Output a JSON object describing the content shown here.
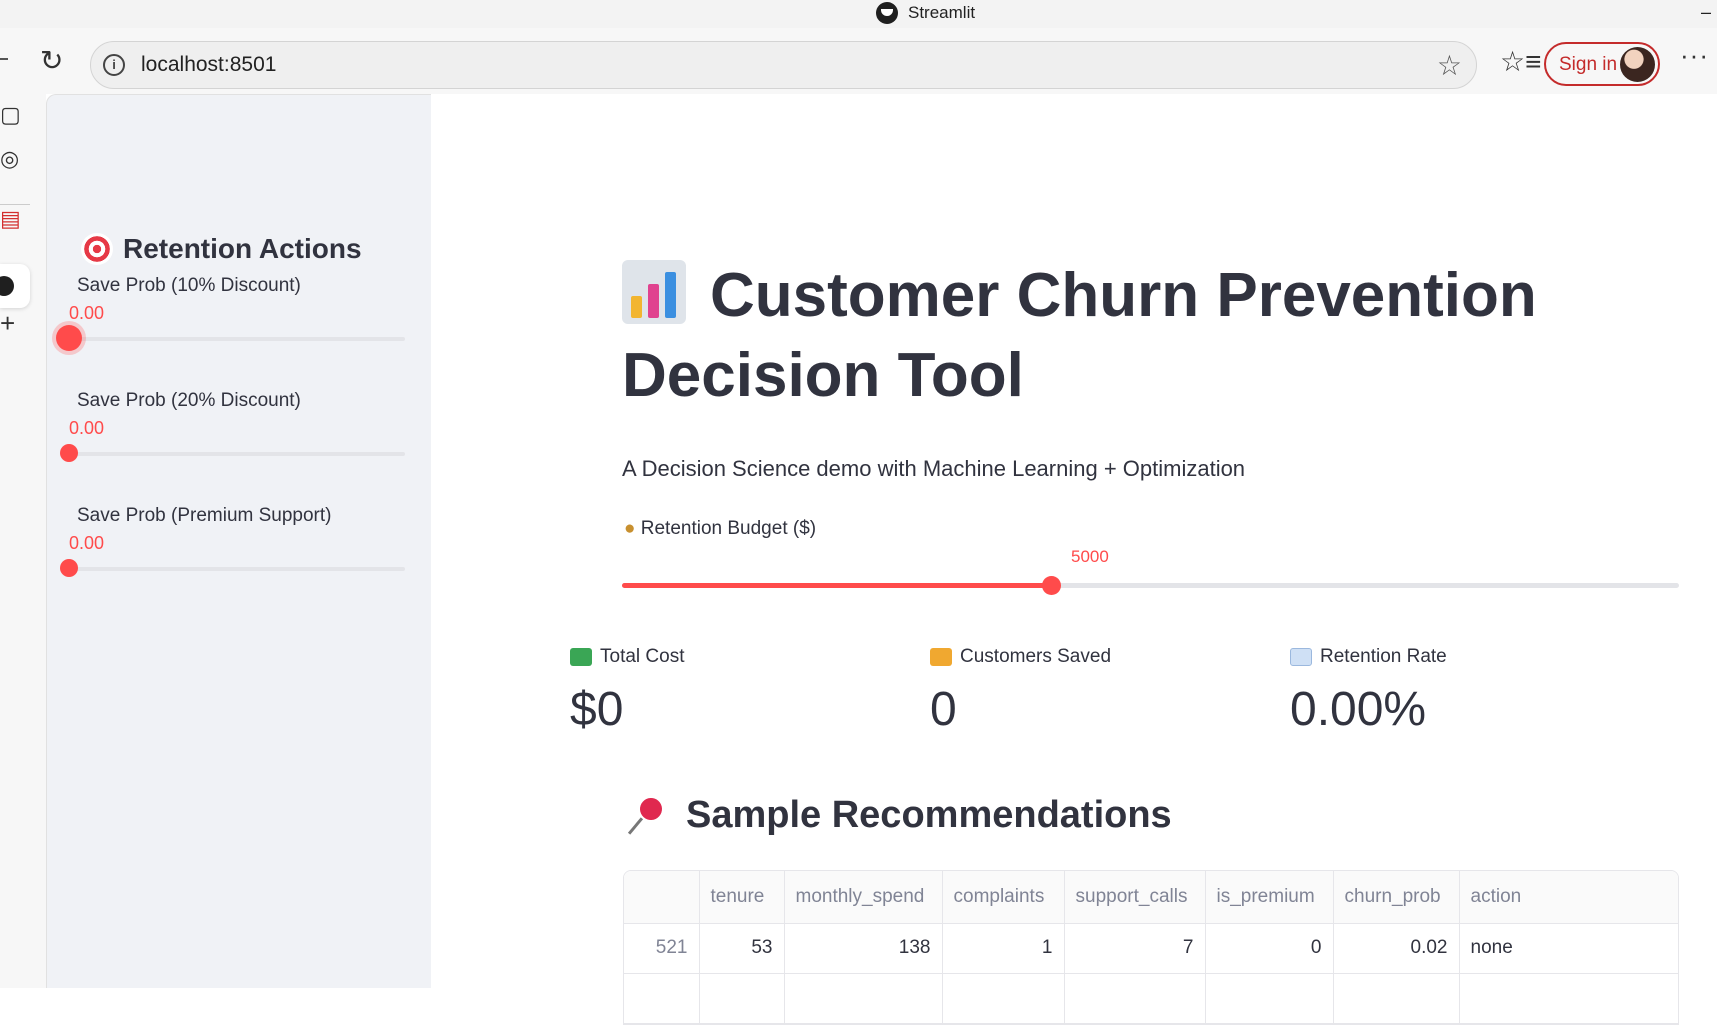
{
  "window": {
    "title": "Streamlit"
  },
  "browser": {
    "url": "localhost:8501",
    "sign_in_label": "Sign in"
  },
  "sidebar": {
    "heading": "Retention Actions",
    "sliders": [
      {
        "label": "Save Prob (10% Discount)",
        "value": "0.00"
      },
      {
        "label": "Save Prob (20% Discount)",
        "value": "0.00"
      },
      {
        "label": "Save Prob (Premium Support)",
        "value": "0.00"
      }
    ]
  },
  "main": {
    "title": "Customer Churn Prevention Decision Tool",
    "subtitle": "A Decision Science demo with Machine Learning + Optimization",
    "budget": {
      "label": "Retention Budget ($)",
      "value": "5000",
      "fraction": 0.5
    },
    "metrics": [
      {
        "label": "Total Cost",
        "value": "$0"
      },
      {
        "label": "Customers Saved",
        "value": "0"
      },
      {
        "label": "Retention Rate",
        "value": "0.00%"
      }
    ],
    "section_title": "Sample Recommendations",
    "table": {
      "columns": [
        "",
        "tenure",
        "monthly_spend",
        "complaints",
        "support_calls",
        "is_premium",
        "churn_prob",
        "action"
      ],
      "rows": [
        [
          "521",
          "53",
          "138",
          "1",
          "7",
          "0",
          "0.02",
          "none"
        ]
      ]
    }
  },
  "colors": {
    "accent": "#ff4b4b",
    "text": "#31333f",
    "sidebar_bg": "#f0f2f6"
  }
}
